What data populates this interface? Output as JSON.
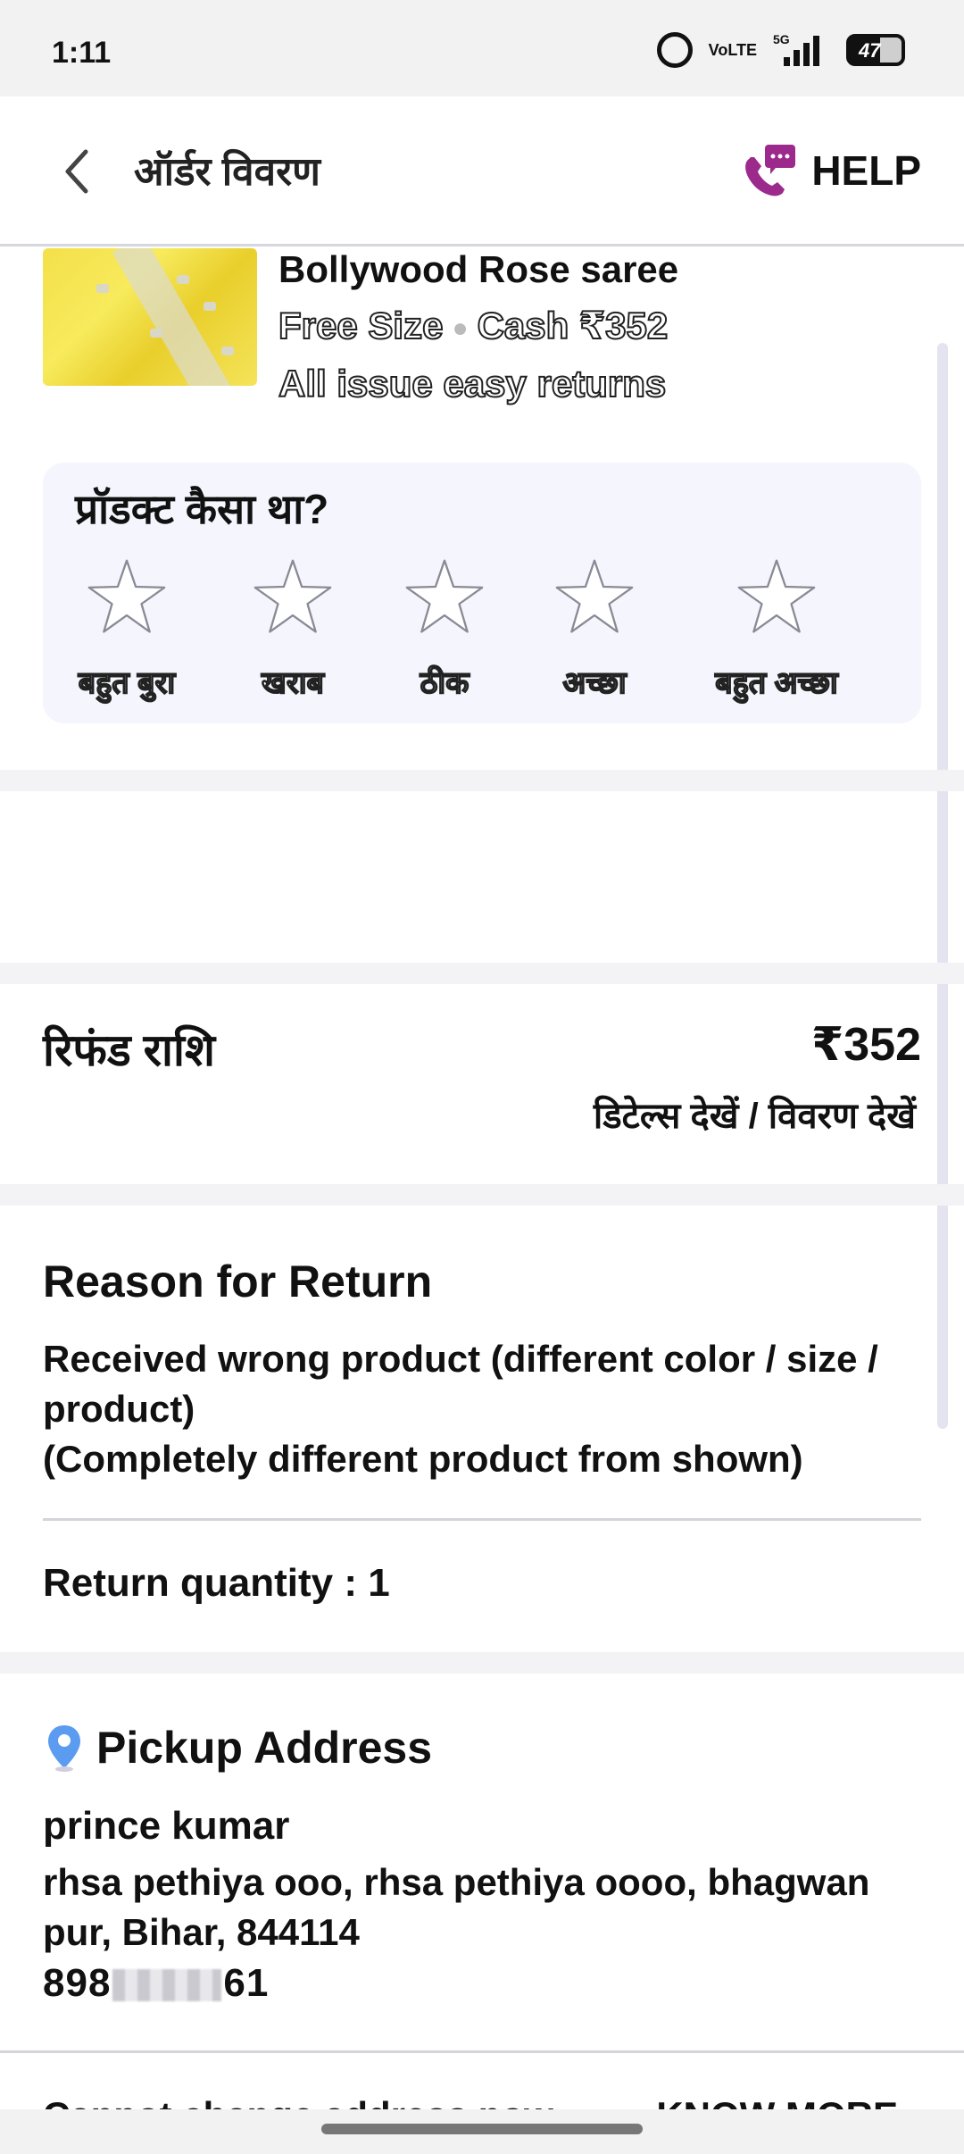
{
  "status_bar": {
    "time": "1:11",
    "volte_top": "Vo",
    "volte_bottom": "LTE",
    "network": "5G",
    "battery": "47"
  },
  "header": {
    "title": "ऑर्डर विवरण",
    "help_label": "HELP",
    "icons": {
      "back": "chevron-left-icon",
      "help": "phone-chat-icon"
    },
    "accent_color": "#9c2a8c"
  },
  "product": {
    "name": "Bollywood Rose saree",
    "size": "Free Size",
    "payment": "Cash ₹352",
    "returns": "All issue easy returns"
  },
  "rating": {
    "question": "प्रॉडक्ट कैसा था?",
    "options": [
      "बहुत बुरा",
      "खराब",
      "ठीक",
      "अच्छा",
      "बहुत अच्छा"
    ],
    "selected": 0
  },
  "refund": {
    "label": "रिफंड राशि",
    "amount": "₹352",
    "details": "डिटेल्स देखें / विवरण देखें"
  },
  "return_reason": {
    "title": "Reason for Return",
    "line1": "Received wrong product (different color / size / product)",
    "line2": "(Completely different product from shown)",
    "quantity": "Return quantity : 1"
  },
  "pickup": {
    "title": "Pickup Address",
    "name": "prince kumar",
    "address": "rhsa pethiya ooo, rhsa pethiya oooo, bhagwan pur, Bihar, 844114",
    "phone_start": "898",
    "phone_end": "61"
  },
  "footer": {
    "notice": "Cannot change address now",
    "know_more": "KNOW MORE"
  }
}
